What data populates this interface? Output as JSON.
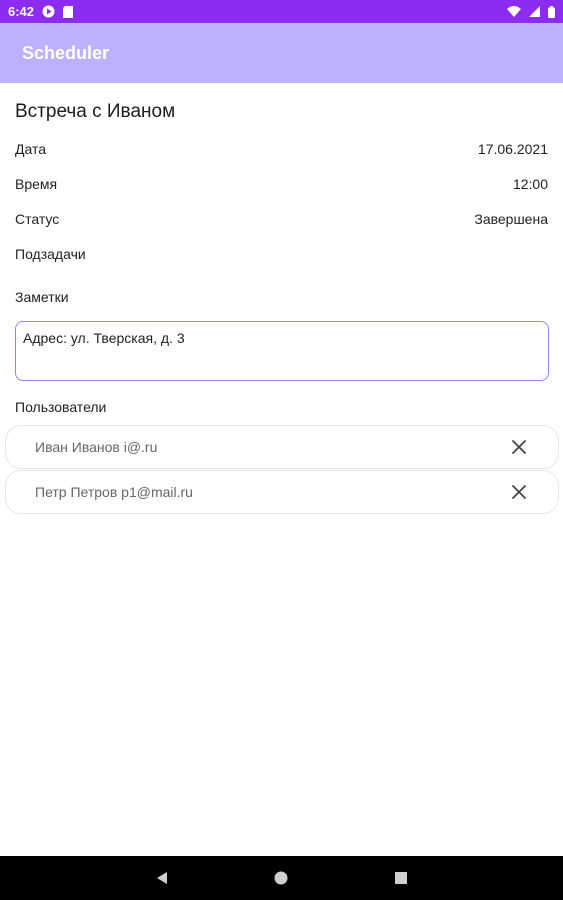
{
  "status_bar": {
    "time": "6:42",
    "icons": [
      "g-play-icon",
      "sd-card-icon",
      "wifi-icon",
      "signal-icon",
      "battery-icon"
    ],
    "color": "#8b2cf0"
  },
  "app_bar": {
    "title": "Scheduler",
    "color": "#bcb1ff"
  },
  "task": {
    "title": "Встреча с Иваном",
    "fields": [
      {
        "label": "Дата",
        "value": "17.06.2021"
      },
      {
        "label": "Время",
        "value": "12:00"
      },
      {
        "label": "Статус",
        "value": "Завершена"
      }
    ],
    "subtasks_label": "Подзадачи",
    "notes_label": "Заметки",
    "notes_value": "Адрес: ул. Тверская, д. 3",
    "users_label": "Пользователи",
    "users": [
      {
        "text": "Иван Иванов i@.ru"
      },
      {
        "text": "Петр Петров p1@mail.ru"
      }
    ]
  },
  "nav_bar": {
    "buttons": [
      "back-icon",
      "home-icon",
      "recents-icon"
    ]
  }
}
